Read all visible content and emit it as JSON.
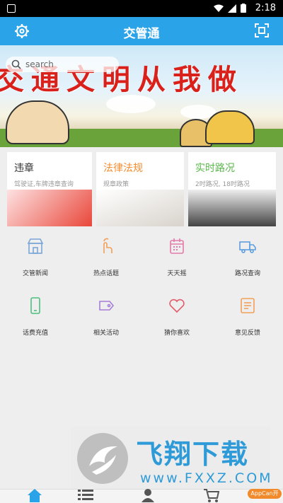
{
  "status_bar": {
    "time": "2:18"
  },
  "header": {
    "title": "交管通"
  },
  "banner": {
    "slogan": "交通文明从我做"
  },
  "search": {
    "placeholder": "search"
  },
  "cards": [
    {
      "title": "违章",
      "subtitle": "驾驶证,车牌违章查询",
      "color": "#333333"
    },
    {
      "title": "法律法规",
      "subtitle": "规章政策",
      "color": "#f28c2e"
    },
    {
      "title": "实时路况",
      "subtitle": "2时路况, 18时路况",
      "color": "#58b84a"
    }
  ],
  "grid": [
    {
      "label": "交管新闻",
      "icon": "shop-icon"
    },
    {
      "label": "热点话题",
      "icon": "hand-pointer-icon"
    },
    {
      "label": "天天摇",
      "icon": "calendar-icon"
    },
    {
      "label": "路况查询",
      "icon": "truck-icon"
    },
    {
      "label": "话费充值",
      "icon": "phone-icon"
    },
    {
      "label": "相关活动",
      "icon": "tag-icon"
    },
    {
      "label": "猜你喜欢",
      "icon": "heart-icon"
    },
    {
      "label": "意见反馈",
      "icon": "feedback-icon"
    }
  ],
  "watermark": {
    "title": "飞翔下载",
    "url": "www.FXXZ.COM"
  },
  "tabbar": [
    {
      "name": "home",
      "icon": "home-icon",
      "active": true
    },
    {
      "name": "list",
      "icon": "list-icon",
      "active": false
    },
    {
      "name": "user",
      "icon": "user-icon",
      "active": false
    },
    {
      "name": "cart",
      "icon": "cart-icon",
      "active": false
    }
  ],
  "badge": {
    "label": "AppCan开"
  },
  "colors": {
    "header": "#2aa3e8",
    "accent": "#2aa3e8",
    "grid_icon": "#f1a05a"
  }
}
